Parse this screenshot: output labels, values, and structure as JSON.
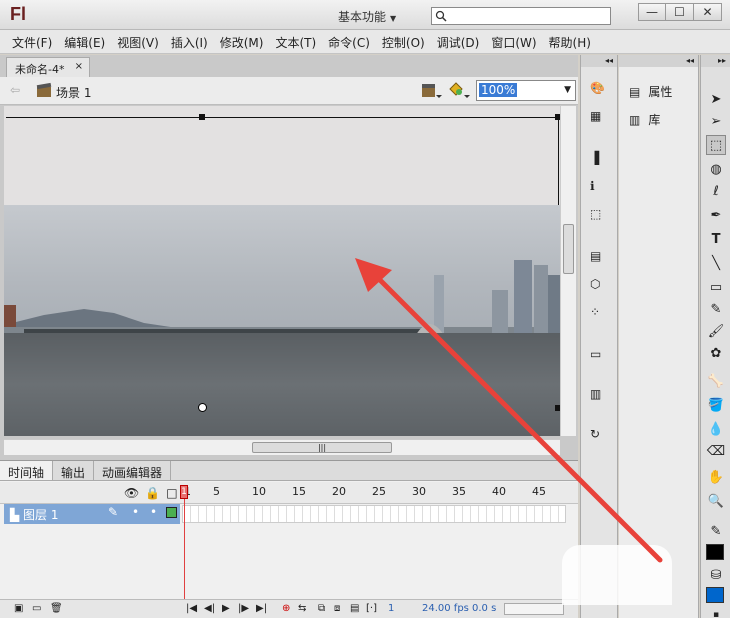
{
  "app": {
    "logo": "Fl",
    "workspace": "基本功能",
    "window_buttons": [
      "—",
      "☐",
      "✕"
    ]
  },
  "menu": [
    "文件(F)",
    "编辑(E)",
    "视图(V)",
    "插入(I)",
    "修改(M)",
    "文本(T)",
    "命令(C)",
    "控制(O)",
    "调试(D)",
    "窗口(W)",
    "帮助(H)"
  ],
  "document": {
    "tab_title": "未命名-4*",
    "tab_close": "×",
    "scene_label": "场景 1",
    "zoom": "100%"
  },
  "timeline": {
    "tabs": [
      "时间轴",
      "输出",
      "动画编辑器"
    ],
    "frame_numbers": [
      "1",
      "5",
      "10",
      "15",
      "20",
      "25",
      "30",
      "35",
      "40",
      "45"
    ],
    "layer_name": "图层 1",
    "playhead": "1",
    "current_frame": "1",
    "fps": "24.00 fps",
    "elapsed": "0.0 s"
  },
  "panels": {
    "properties": "属性",
    "library": "库"
  },
  "colors": {
    "stroke": "#000000",
    "fill": "#0066cc",
    "annotation_arrow": "#e8423a",
    "selected_layer": "#7fa6d6"
  }
}
